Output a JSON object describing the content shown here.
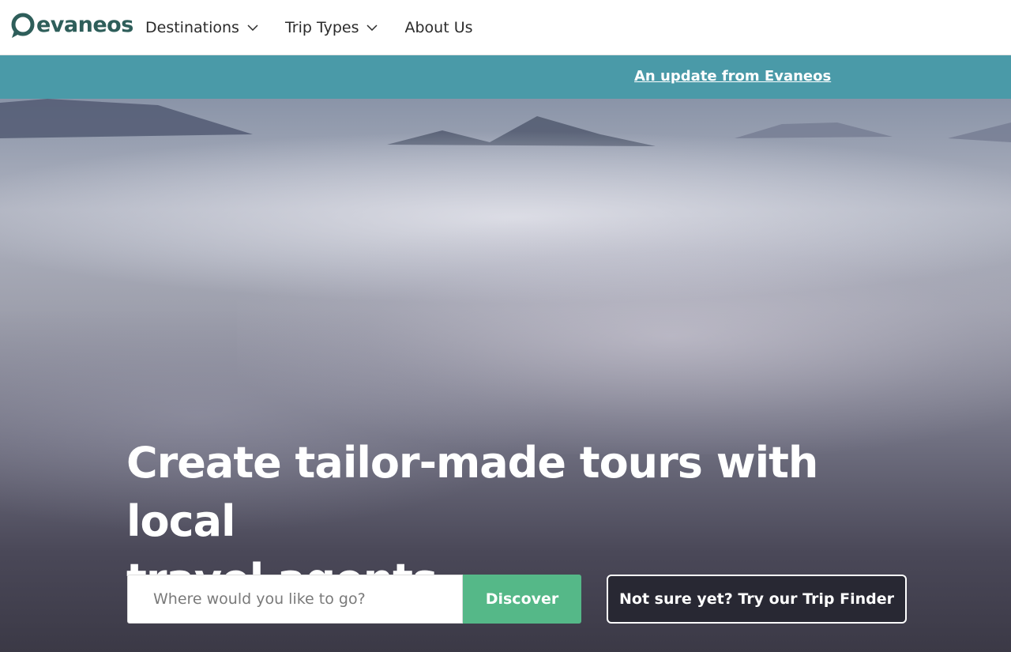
{
  "header": {
    "logo_text": "evaneos",
    "nav": [
      {
        "label": "Destinations",
        "has_dropdown": true
      },
      {
        "label": "Trip Types",
        "has_dropdown": true
      },
      {
        "label": "About Us",
        "has_dropdown": false
      }
    ]
  },
  "banner": {
    "link_text": "An update from Evaneos",
    "background": "#4a9aa8"
  },
  "hero": {
    "headline_line1": "Create tailor-made tours with local",
    "headline_line2": "travel agents",
    "search": {
      "placeholder": "Where would you like to go?",
      "value": ""
    },
    "discover_label": "Discover",
    "trip_finder_label": "Not sure yet? Try our Trip Finder"
  },
  "colors": {
    "brand": "#2e5e5a",
    "accent_green": "#55b888",
    "banner_teal": "#4a9aa8",
    "dark_button": "#282833"
  },
  "icons": [
    "evaneos-logo-icon",
    "chevron-down-icon"
  ]
}
